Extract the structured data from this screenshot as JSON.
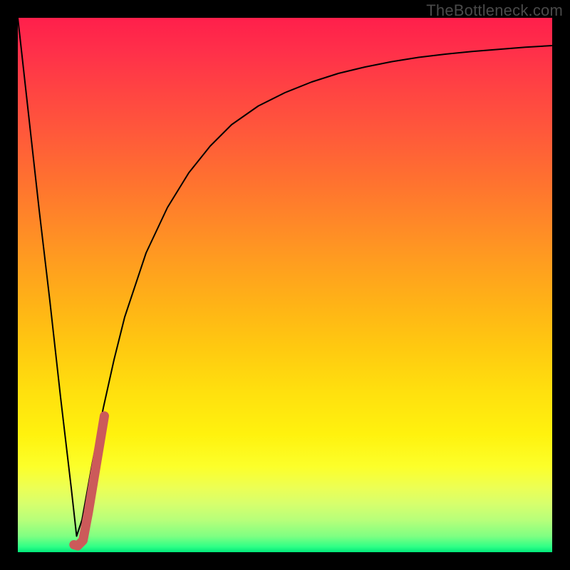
{
  "watermark": {
    "text": "TheBottleneck.com"
  },
  "chart_data": {
    "type": "line",
    "title": "",
    "xlabel": "",
    "ylabel": "",
    "xlim": [
      0,
      100
    ],
    "ylim": [
      0,
      100
    ],
    "grid": false,
    "series": [
      {
        "name": "main-curve",
        "color": "#000000",
        "x": [
          0,
          2,
          4,
          6,
          8,
          10,
          11,
          12,
          14,
          16,
          18,
          20,
          24,
          28,
          32,
          36,
          40,
          45,
          50,
          55,
          60,
          65,
          70,
          75,
          80,
          85,
          90,
          95,
          100
        ],
        "y": [
          100,
          82,
          64,
          47,
          29,
          12,
          3,
          6,
          17,
          27,
          36,
          44,
          56,
          64.5,
          71,
          76,
          80,
          83.5,
          86,
          88,
          89.6,
          90.8,
          91.8,
          92.6,
          93.2,
          93.7,
          94.1,
          94.5,
          94.8
        ]
      },
      {
        "name": "highlight-segment",
        "color": "#cc5a5a",
        "x": [
          10.5,
          11.2,
          12.2,
          13.2,
          14.2,
          15.2,
          16.2
        ],
        "y": [
          1.4,
          1.2,
          2.2,
          7.5,
          13.5,
          19.5,
          25.5
        ]
      }
    ],
    "background": {
      "type": "vertical-gradient",
      "stops": [
        {
          "pos": 0.0,
          "color": "#ff1f4b"
        },
        {
          "pos": 0.5,
          "color": "#ffb416"
        },
        {
          "pos": 0.8,
          "color": "#fcff2a"
        },
        {
          "pos": 1.0,
          "color": "#00e77a"
        }
      ]
    }
  }
}
